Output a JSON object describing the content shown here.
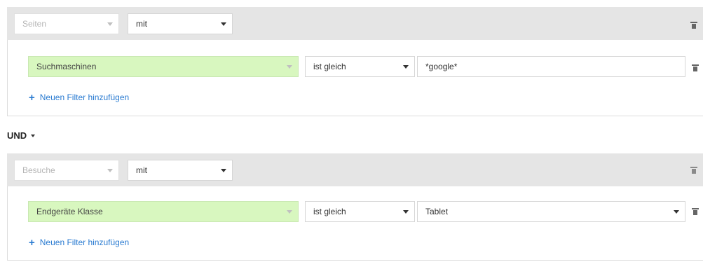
{
  "segments": [
    {
      "scope": {
        "value": "Seiten",
        "disabled": true
      },
      "match": {
        "value": "mit"
      },
      "filters": [
        {
          "dimension": "Suchmaschinen",
          "operator": "ist gleich",
          "value": "*google*",
          "value_is_select": false
        }
      ],
      "add_filter_label": "Neuen Filter hinzufügen"
    },
    {
      "scope": {
        "value": "Besuche",
        "disabled": true
      },
      "match": {
        "value": "mit"
      },
      "filters": [
        {
          "dimension": "Endgeräte Klasse",
          "operator": "ist gleich",
          "value": "Tablet",
          "value_is_select": true
        }
      ],
      "add_filter_label": "Neuen Filter hinzufügen"
    }
  ],
  "connector": {
    "label": "UND"
  },
  "icons": {
    "delete": "trash-icon",
    "dropdown": "chevron-down-icon",
    "add": "plus-icon"
  },
  "colors": {
    "dimension_bg": "#d8f7bf",
    "link": "#2a7bd1",
    "header_bg": "#e5e5e5"
  }
}
